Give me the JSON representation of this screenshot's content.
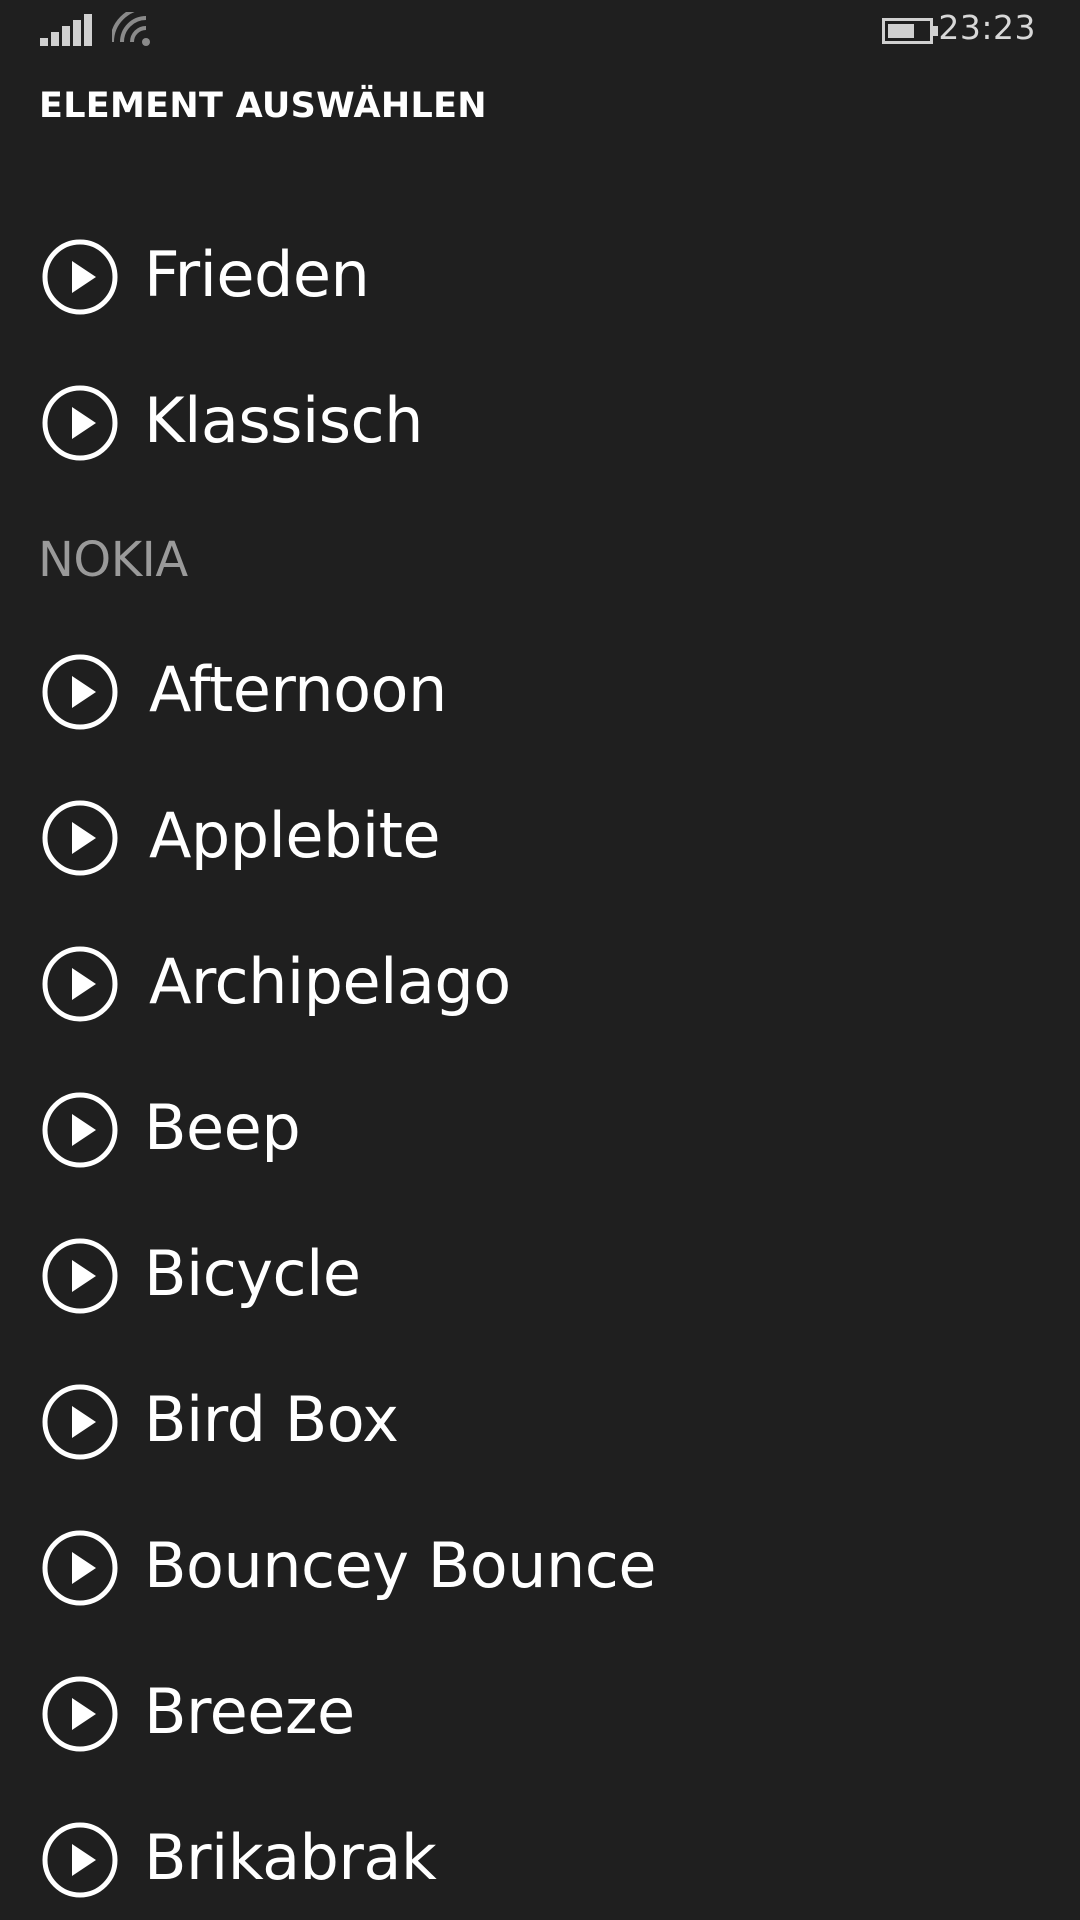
{
  "status_bar": {
    "time": "23:23",
    "icons": [
      "signal-icon",
      "wifi-icon",
      "battery-icon"
    ]
  },
  "page": {
    "title": "ELEMENT AUSWÄHLEN"
  },
  "groups": [
    {
      "header": "",
      "items": [
        {
          "label": "Frieden"
        },
        {
          "label": "Klassisch"
        }
      ]
    },
    {
      "header": "NOKIA",
      "items": [
        {
          "label": "Afternoon"
        },
        {
          "label": "Applebite"
        },
        {
          "label": "Archipelago"
        },
        {
          "label": "Beep"
        },
        {
          "label": "Bicycle"
        },
        {
          "label": "Bird Box"
        },
        {
          "label": "Bouncey Bounce"
        },
        {
          "label": "Breeze"
        },
        {
          "label": "Brikabrak"
        }
      ]
    }
  ],
  "colors": {
    "background": "#1f1f1f",
    "text": "#ffffff",
    "section_header": "#9a9a9a"
  }
}
